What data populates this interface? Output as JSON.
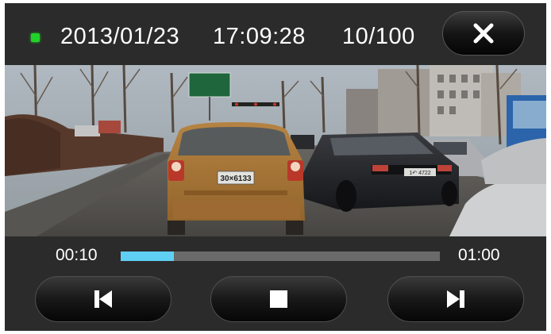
{
  "header": {
    "recording_indicator_color": "#22d12a",
    "date": "2013/01/23",
    "time": "17:09:28",
    "file_counter": "10/100",
    "close_icon": "close-icon"
  },
  "video": {
    "description_icon": "dashcam-video-frame",
    "plates": {
      "front_car": "30×6133",
      "right_car": "1↶ 4722"
    }
  },
  "playback": {
    "elapsed": "00:10",
    "total": "01:00",
    "progress_fraction": 0.167,
    "progress_color": "#5fd0f4"
  },
  "controls": {
    "previous_icon": "skip-previous-icon",
    "stop_icon": "stop-icon",
    "next_icon": "skip-next-icon"
  }
}
